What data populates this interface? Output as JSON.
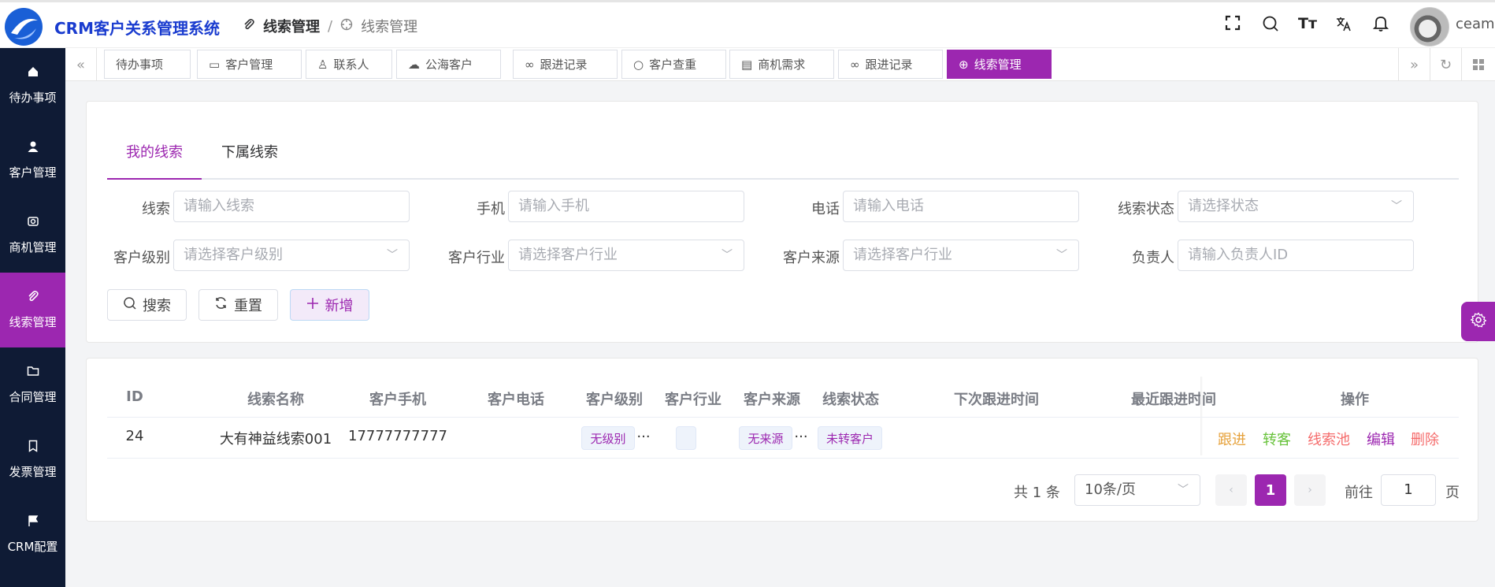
{
  "header": {
    "app_name": "CRM客户关系管理系统",
    "breadcrumb": [
      "线索管理",
      "/",
      "线索管理"
    ],
    "user": "ceam"
  },
  "sidebar": {
    "items": [
      {
        "label": "待办事项",
        "icon": "home-icon"
      },
      {
        "label": "客户管理",
        "icon": "user-icon"
      },
      {
        "label": "商机管理",
        "icon": "opportunity-icon"
      },
      {
        "label": "线索管理",
        "icon": "paperclip-icon"
      },
      {
        "label": "合同管理",
        "icon": "folder-icon"
      },
      {
        "label": "发票管理",
        "icon": "bookmark-icon"
      },
      {
        "label": "CRM配置",
        "icon": "flag-icon"
      }
    ]
  },
  "tags": [
    "待办事项",
    "客户管理",
    "联系人",
    "公海客户",
    "跟进记录",
    "客户查重",
    "商机需求",
    "跟进记录",
    "线索管理"
  ],
  "subtabs": [
    "我的线索",
    "下属线索"
  ],
  "search": {
    "lead_label": "线索",
    "lead_ph": "请输入线索",
    "mobile_label": "手机",
    "mobile_ph": "请输入手机",
    "phone_label": "电话",
    "phone_ph": "请输入电话",
    "status_label": "线索状态",
    "status_ph": "请选择状态",
    "level_label": "客户级别",
    "level_ph": "请选择客户级别",
    "industry_label": "客户行业",
    "industry_ph": "请选择客户行业",
    "source_label": "客户来源",
    "source_ph": "请选择客户行业",
    "owner_label": "负责人",
    "owner_ph": "请输入负责人ID",
    "search_btn": "搜索",
    "reset_btn": "重置",
    "add_btn": "新增"
  },
  "table": {
    "columns": [
      "ID",
      "线索名称",
      "客户手机",
      "客户电话",
      "客户级别",
      "客户行业",
      "客户来源",
      "线索状态",
      "下次跟进时间",
      "最近跟进时间",
      "操作"
    ],
    "rows": [
      {
        "id": "24",
        "name": "大有神益线索001",
        "mobile": "17777777777",
        "phone": "",
        "level": "无级别",
        "level_more": "...",
        "industry": "",
        "source": "无来源",
        "source_more": "...",
        "status": "未转客户",
        "next": "",
        "last": ""
      }
    ],
    "actions": [
      {
        "label": "跟进",
        "color": "#e6a23c"
      },
      {
        "label": "转客",
        "color": "#67c23a"
      },
      {
        "label": "线索池",
        "color": "#f56c6c"
      },
      {
        "label": "编辑",
        "color": "#9c27b0"
      },
      {
        "label": "删除",
        "color": "#f56c6c"
      }
    ]
  },
  "pagination": {
    "total": "共 1 条",
    "page_size": "10条/页",
    "current": "1",
    "goto_label": "前往",
    "goto_value": "1",
    "page_unit": "页"
  },
  "colors": {
    "accent": "#9c27b0",
    "sidebar": "#0f1b35",
    "brand": "#1a3ccf"
  }
}
